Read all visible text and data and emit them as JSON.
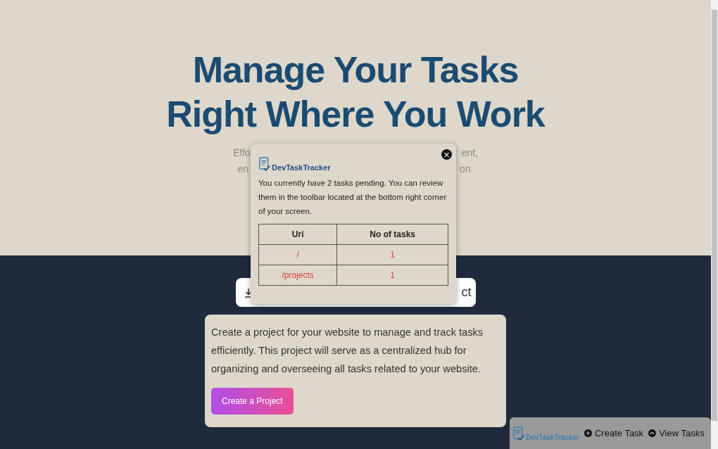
{
  "hero": {
    "title_lines": [
      "Manage Your Tasks",
      "Right Where You Work"
    ],
    "subtitle_fragments": [
      {
        "left": "Effo",
        "right": "ent,"
      },
      {
        "left": "en",
        "right": "on."
      }
    ]
  },
  "action_bar": {
    "visible_text": "ct"
  },
  "project_card": {
    "text": "Create a project for your website to manage and track tasks efficiently. This project will serve as a centralized hub for organizing and overseeing all tasks related to your website.",
    "button": "Create a Project"
  },
  "popup": {
    "brand": "DevTaskTracker",
    "close": "×",
    "message": "You currently have 2 tasks pending. You can review them in the toolbar located at the bottom right corner of your screen.",
    "columns": [
      "Uri",
      "No of tasks"
    ],
    "rows": [
      [
        "/",
        "1"
      ],
      [
        "/projects",
        "1"
      ]
    ]
  },
  "toolbar": {
    "brand": "DevTaskTracker",
    "buttons": [
      {
        "label": "Create Task",
        "kind": "create"
      },
      {
        "label": "View Tasks",
        "kind": "view"
      }
    ]
  }
}
